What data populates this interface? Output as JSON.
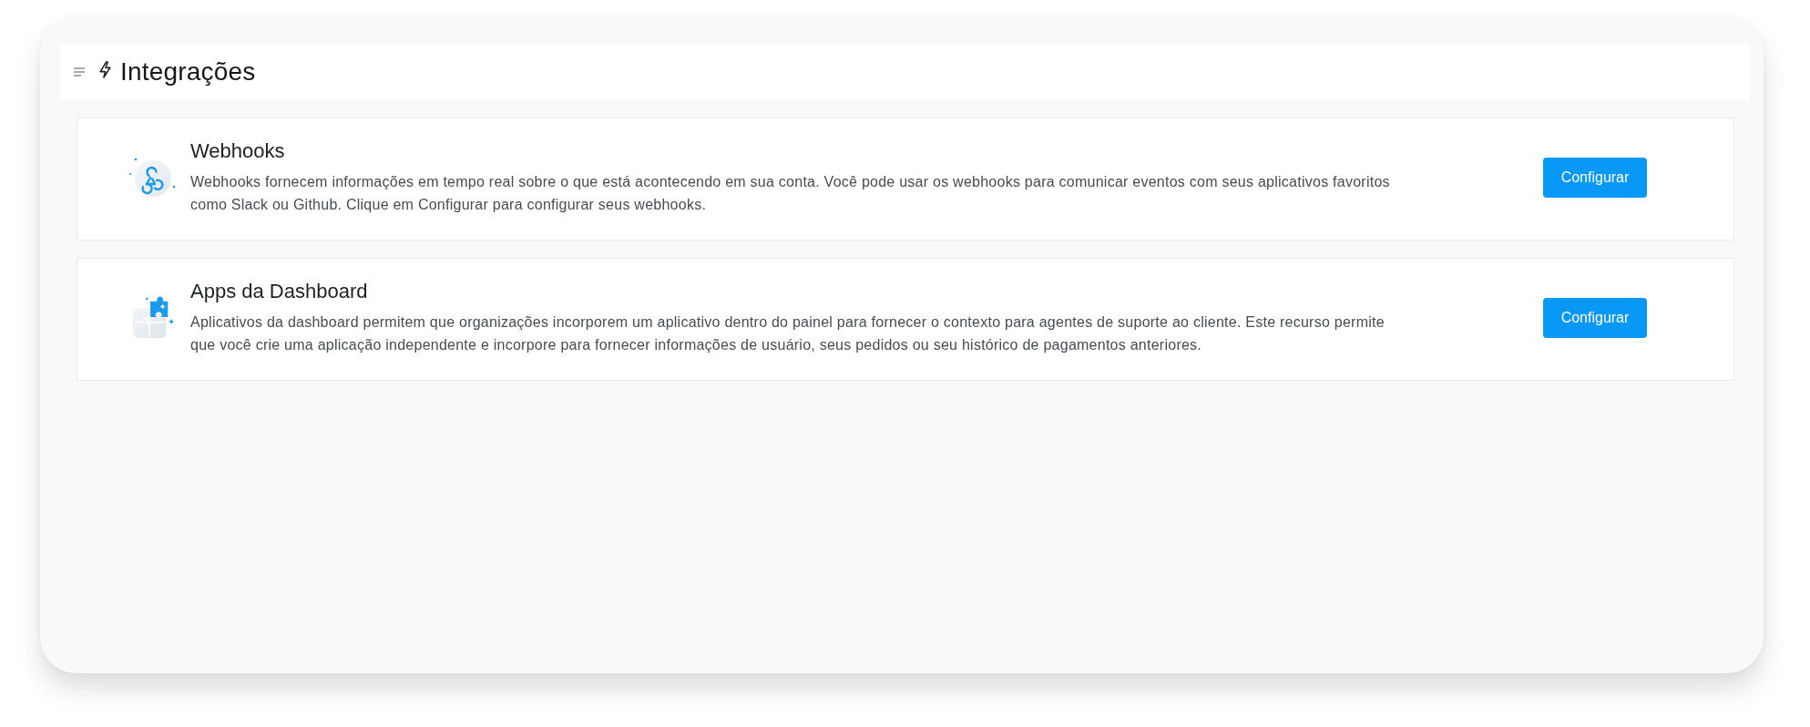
{
  "header": {
    "title": "Integrações"
  },
  "integrations": [
    {
      "kind": "webhooks",
      "title": "Webhooks",
      "description": "Webhooks fornecem informações em tempo real sobre o que está acontecendo em sua conta. Você pode usar os webhooks para comunicar eventos com seus aplicativos favoritos como Slack ou Github. Clique em Configurar para configurar seus webhooks.",
      "button": "Configurar"
    },
    {
      "kind": "apps",
      "title": "Apps da Dashboard",
      "description": "Aplicativos da dashboard permitem que organizações incorporem um aplicativo dentro do painel para fornecer o contexto para agentes de suporte ao cliente. Este recurso permite que você crie uma aplicação independente e incorpore para fornecer informações de usuário, seus pedidos ou seu histórico de pagamentos anteriores.",
      "button": "Configurar"
    }
  ]
}
